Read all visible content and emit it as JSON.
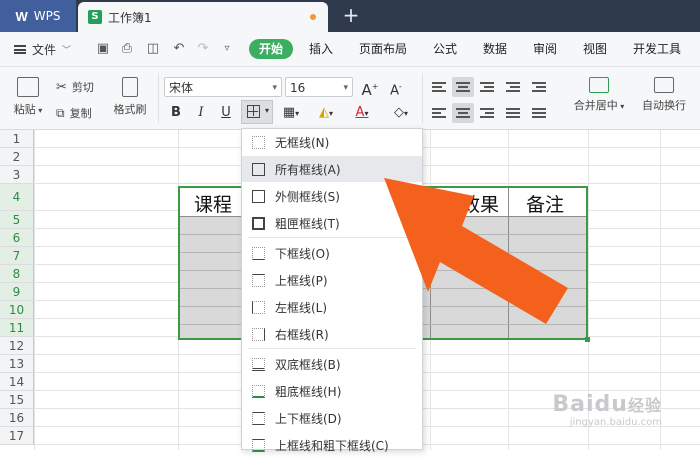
{
  "app": {
    "name": "WPS"
  },
  "doc_tab": {
    "title": "工作簿1"
  },
  "menu": {
    "file_label": "文件",
    "tabs": [
      "开始",
      "插入",
      "页面布局",
      "公式",
      "数据",
      "审阅",
      "视图",
      "开发工具"
    ],
    "active_tab": "开始"
  },
  "toolbar": {
    "paste": "粘贴",
    "cut": "剪切",
    "copy": "复制",
    "format_painter": "格式刷",
    "font_name": "宋体",
    "font_size": "16",
    "merge_center": "合并居中",
    "wrap_text": "自动换行"
  },
  "sheet": {
    "rows": [
      "1",
      "2",
      "3",
      "4",
      "5",
      "6",
      "7",
      "8",
      "9",
      "10",
      "11",
      "12",
      "13",
      "14",
      "15",
      "16",
      "17"
    ],
    "header_cells": [
      "课程",
      "...果",
      "备注"
    ],
    "header_partial": "术效果",
    "header_first": "课程",
    "header_last": "备注"
  },
  "border_menu": {
    "items": [
      "无框线(N)",
      "所有框线(A)",
      "外侧框线(S)",
      "粗匣框线(T)",
      "下框线(O)",
      "上框线(P)",
      "左框线(L)",
      "右框线(R)",
      "双底框线(B)",
      "粗底框线(H)",
      "上下框线(D)",
      "上框线和粗下框线(C)"
    ],
    "highlighted": "所有框线(A)"
  },
  "watermark": {
    "brand": "Baidu",
    "suffix": "经验",
    "url": "jingyan.baidu.com"
  },
  "colors": {
    "accent_green": "#3bae62",
    "arrow_orange": "#f4611c",
    "title_bg": "#2f3a4d"
  }
}
